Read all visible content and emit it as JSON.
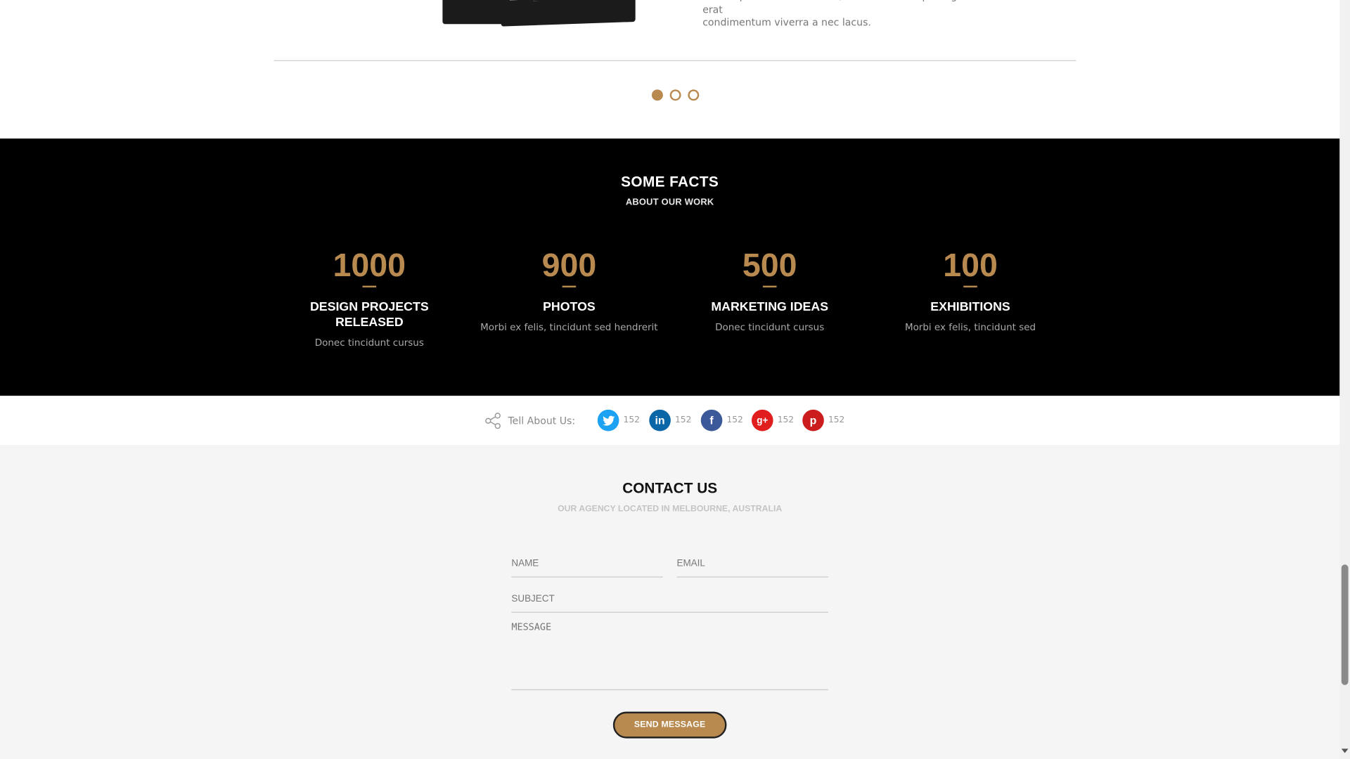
{
  "testimonial": {
    "text_line1": "Lorem ipsum dolor sit amet, consectetur adipiscing elit. Sed vel eros vitae erat",
    "text_line2": "condimentum viverra a nec lacus.",
    "slider_dots": [
      true,
      false,
      false
    ]
  },
  "facts": {
    "title": "SOME FACTS",
    "subtitle": "ABOUT OUR WORK",
    "items": [
      {
        "number": "1000",
        "title_line1": "DESIGN PROJECTS",
        "title_line2": "RELEASED",
        "desc": "Donec tincidunt cursus"
      },
      {
        "number": "900",
        "title_line1": "PHOTOS",
        "title_line2": "",
        "desc": "Morbi ex felis, tincidunt sed hendrerit"
      },
      {
        "number": "500",
        "title_line1": "MARKETING IDEAS",
        "title_line2": "",
        "desc": "Donec tincidunt cursus"
      },
      {
        "number": "100",
        "title_line1": "EXHIBITIONS",
        "title_line2": "",
        "desc": "Morbi ex felis, tincidunt sed"
      }
    ]
  },
  "share": {
    "label": "Tell About Us:",
    "networks": [
      {
        "name": "twitter-icon",
        "glyph": "t",
        "color": "#1da1f2",
        "count": "152"
      },
      {
        "name": "linkedin-icon",
        "glyph": "in",
        "color": "#0a66a6",
        "count": "152"
      },
      {
        "name": "facebook-icon",
        "glyph": "f",
        "color": "#3b5998",
        "count": "152"
      },
      {
        "name": "google-plus-icon",
        "glyph": "g+",
        "color": "#e01e1e",
        "count": "152"
      },
      {
        "name": "pinterest-icon",
        "glyph": "p",
        "color": "#cb1d1d",
        "count": "152"
      }
    ]
  },
  "contact": {
    "title": "CONTACT US",
    "subtitle": "OUR AGENCY LOCATED IN MELBOURNE, AUSTRALIA",
    "name_placeholder": "NAME",
    "email_placeholder": "EMAIL",
    "subject_placeholder": "SUBJECT",
    "message_placeholder": "MESSAGE",
    "send_label": "SEND MESSAGE"
  },
  "colors": {
    "accent": "#b88a4f",
    "facts_bg": "#000000",
    "contact_bg": "#f5f5f5"
  }
}
